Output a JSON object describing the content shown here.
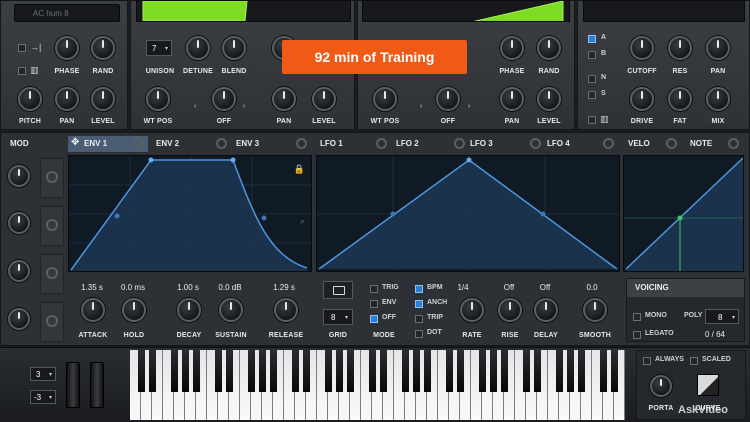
{
  "banner": {
    "text": "92 min of Training"
  },
  "top_bar": {
    "preset_name": "AC hum 8"
  },
  "osc_a": {
    "knobs": [
      "PHASE",
      "RAND",
      "PITCH",
      "PAN",
      "LEVEL"
    ]
  },
  "osc_b": {
    "unison_value": "7",
    "knobs": [
      "UNISON",
      "DETUNE",
      "BLEND",
      "WT POS",
      "OFF"
    ]
  },
  "osc_c": {
    "knobs": [
      "PAN",
      "LEVEL"
    ]
  },
  "osc_d": {
    "knobs": [
      "PHASE",
      "RAND",
      "WT POS",
      "OFF",
      "PAN",
      "LEVEL"
    ]
  },
  "filter": {
    "routes": [
      "A",
      "B",
      "N",
      "S"
    ],
    "knobs": [
      "CUTOFF",
      "RES",
      "PAN",
      "DRIVE",
      "FAT",
      "MIX"
    ]
  },
  "mod_tabs": {
    "mod": "MOD",
    "env": [
      "ENV 1",
      "ENV 2",
      "ENV 3"
    ],
    "lfo": [
      "LFO 1",
      "LFO 2",
      "LFO 3",
      "LFO 4"
    ],
    "velo": "VELO",
    "note": "NOTE"
  },
  "env": {
    "values": [
      "1.35 s",
      "0.0 ms",
      "1.00 s",
      "0.0 dB",
      "1.29 s"
    ],
    "labels": [
      "ATTACK",
      "HOLD",
      "DECAY",
      "SUSTAIN",
      "RELEASE"
    ]
  },
  "lfo": {
    "grid_value": "8",
    "grid_label": "GRID",
    "mode_options": [
      "TRIG",
      "ENV",
      "OFF"
    ],
    "mode_label": "MODE",
    "bpm_options": [
      "BPM",
      "ANCH",
      "TRIP",
      "DOT"
    ],
    "values": [
      "1/4",
      "Off",
      "Off",
      "0.0"
    ],
    "labels": [
      "RATE",
      "RISE",
      "DELAY",
      "SMOOTH"
    ]
  },
  "voicing": {
    "title": "VOICING",
    "mono": "MONO",
    "poly": "POLY",
    "poly_value": "8",
    "legato": "LEGATO",
    "voices": "0 / 64"
  },
  "keyboard": {
    "octave_up": "3",
    "octave_down": "-3"
  },
  "portamento": {
    "always": "ALWAYS",
    "scaled": "SCALED",
    "porta": "PORTA",
    "curve": "CURVE"
  },
  "watermark": "AskVideo"
}
